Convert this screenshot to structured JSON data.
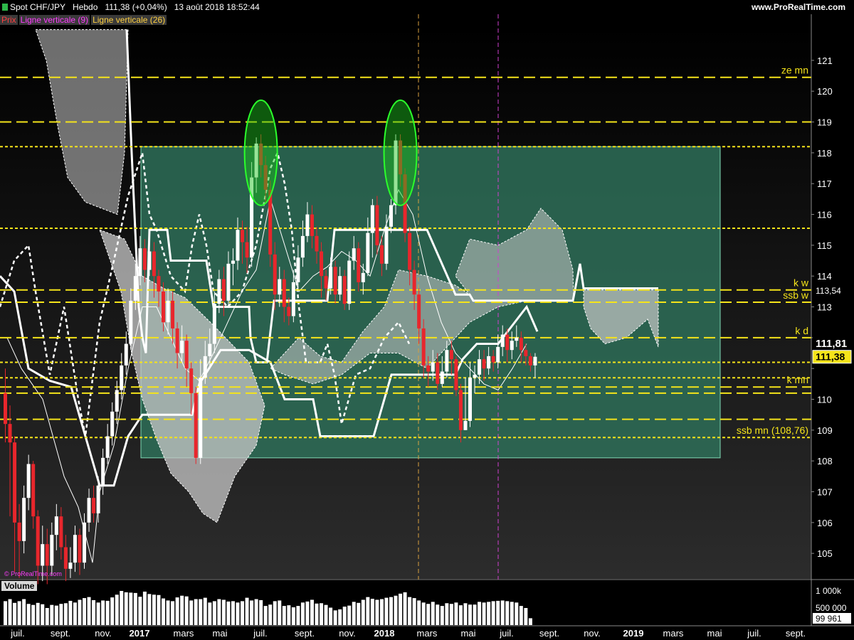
{
  "header": {
    "instrument": "Spot CHF/JPY",
    "timeframe": "Hebdo",
    "last_change": "111,38 (+0,04%)",
    "datetime": "13 août 2018 18:52:44",
    "site": "www.ProRealTime.com"
  },
  "indicators": {
    "price": "Prix",
    "vline9": "Ligne verticale (9)",
    "vline26": "Ligne verticale (26)",
    "colors": {
      "price": "#ff4040",
      "vline9": "#ff3cff",
      "vline26": "#ffd040"
    }
  },
  "copyright": "© ProRealTime.com",
  "volume_title": "Volume",
  "colors": {
    "up": "#ffffff",
    "down": "#e8262c",
    "level": "#f5e41a",
    "box_fill": "#2e6e58",
    "cloud": "#c8c8c8",
    "ellipse": "#19c019"
  },
  "chart_data": [
    {
      "type": "candlestick",
      "title": "Spot CHF/JPY",
      "x_ticks": [
        "juil.",
        "sept.",
        "nov.",
        "2017",
        "mars",
        "mai",
        "juil.",
        "sept.",
        "nov.",
        "2018",
        "mars",
        "mai",
        "juil.",
        "sept.",
        "nov.",
        "2019",
        "mars",
        "mai",
        "juil.",
        "sept."
      ],
      "ylim": [
        104,
        122
      ],
      "y_ticks": [
        105,
        106,
        107,
        108,
        109,
        110,
        111,
        112,
        113,
        114,
        115,
        116,
        117,
        118,
        119,
        120,
        121
      ],
      "y_tick_labels": [
        "105",
        "106",
        "107",
        "108",
        "109",
        "110",
        "",
        "",
        "113",
        "114",
        "115",
        "116",
        "117",
        "118",
        "119",
        "120",
        "121"
      ],
      "last_price": "111,38",
      "price_tags": [
        "113,54",
        "111,81",
        "111,38"
      ],
      "levels": [
        {
          "label": "ze mn",
          "value": 120.45,
          "style": "long-dash"
        },
        {
          "label": "",
          "value": 119.0,
          "style": "long-dash"
        },
        {
          "label": "",
          "value": 118.2,
          "style": "short-dash"
        },
        {
          "label": "",
          "value": 115.55,
          "style": "short-dash"
        },
        {
          "label": "k w",
          "value": 113.55,
          "style": "long-dash"
        },
        {
          "label": "ssb w",
          "value": 113.15,
          "style": "long-dash"
        },
        {
          "label": "k d",
          "value": 112.0,
          "style": "long-dash"
        },
        {
          "label": "",
          "value": 111.2,
          "style": "short-dash"
        },
        {
          "label": "",
          "value": 110.7,
          "style": "short-dash"
        },
        {
          "label": "k mn",
          "value": 110.4,
          "style": "long-dash"
        },
        {
          "label": "",
          "value": 110.2,
          "style": "long-dash"
        },
        {
          "label": "",
          "value": 109.35,
          "style": "long-dash"
        },
        {
          "label": "ssb mn (108,76)",
          "value": 108.76,
          "style": "short-dash"
        }
      ],
      "candles": [
        [
          110.2,
          109.2,
          111.0,
          108.6
        ],
        [
          109.2,
          108.6,
          109.8,
          106.2
        ],
        [
          108.6,
          106.0,
          108.8,
          104.4
        ],
        [
          106.0,
          105.4,
          106.6,
          104.2
        ],
        [
          105.4,
          106.8,
          107.2,
          105.0
        ],
        [
          106.8,
          107.9,
          108.2,
          106.4
        ],
        [
          107.9,
          106.2,
          108.0,
          105.8
        ],
        [
          106.2,
          104.6,
          106.4,
          104.0
        ],
        [
          104.6,
          105.3,
          105.9,
          104.1
        ],
        [
          105.3,
          104.6,
          105.8,
          104.0
        ],
        [
          104.6,
          105.6,
          106.0,
          104.3
        ],
        [
          105.6,
          106.2,
          106.6,
          105.1
        ],
        [
          106.2,
          105.2,
          106.5,
          104.8
        ],
        [
          105.2,
          104.5,
          105.6,
          104.1
        ],
        [
          104.5,
          104.7,
          105.2,
          104.2
        ],
        [
          104.7,
          105.6,
          105.9,
          104.4
        ],
        [
          105.6,
          104.7,
          105.8,
          104.3
        ],
        [
          104.7,
          106.0,
          106.3,
          104.5
        ],
        [
          106.0,
          106.8,
          107.1,
          105.7
        ],
        [
          106.8,
          106.3,
          107.2,
          106.0
        ],
        [
          106.3,
          107.2,
          107.5,
          106.0
        ],
        [
          107.2,
          108.1,
          108.4,
          106.9
        ],
        [
          108.1,
          108.8,
          109.2,
          107.9
        ],
        [
          108.8,
          109.6,
          109.9,
          108.5
        ],
        [
          109.6,
          110.3,
          110.6,
          109.2
        ],
        [
          110.3,
          111.1,
          111.5,
          110.0
        ],
        [
          111.1,
          111.8,
          112.2,
          110.8
        ],
        [
          111.8,
          113.2,
          113.6,
          111.6
        ],
        [
          113.2,
          114.0,
          114.4,
          112.9
        ],
        [
          114.0,
          114.9,
          115.3,
          113.7
        ],
        [
          114.9,
          114.2,
          115.2,
          113.8
        ],
        [
          114.2,
          114.8,
          115.4,
          114.0
        ],
        [
          114.8,
          114.0,
          115.1,
          113.3
        ],
        [
          114.0,
          113.5,
          114.2,
          113.0
        ],
        [
          113.5,
          112.5,
          113.8,
          112.2
        ],
        [
          112.5,
          113.2,
          113.6,
          112.1
        ],
        [
          113.2,
          112.3,
          113.5,
          111.8
        ],
        [
          112.3,
          111.5,
          112.5,
          111.0
        ],
        [
          111.5,
          111.9,
          112.4,
          111.2
        ],
        [
          111.9,
          111.0,
          112.1,
          110.4
        ],
        [
          111.0,
          110.2,
          111.2,
          109.5
        ],
        [
          110.2,
          108.1,
          110.4,
          107.9
        ],
        [
          108.1,
          110.7,
          111.3,
          107.9
        ],
        [
          110.7,
          111.4,
          111.9,
          110.5
        ],
        [
          111.4,
          111.8,
          112.3,
          111.0
        ],
        [
          111.8,
          113.1,
          113.5,
          111.5
        ],
        [
          113.1,
          113.9,
          114.2,
          112.8
        ],
        [
          113.9,
          113.2,
          114.3,
          112.7
        ],
        [
          113.2,
          114.4,
          114.8,
          113.0
        ],
        [
          114.4,
          114.5,
          114.9,
          113.7
        ],
        [
          114.5,
          115.5,
          115.9,
          114.2
        ],
        [
          115.5,
          115.1,
          115.8,
          114.4
        ],
        [
          115.1,
          114.6,
          115.6,
          114.1
        ],
        [
          114.6,
          117.2,
          117.7,
          114.3
        ],
        [
          117.2,
          118.3,
          118.5,
          116.7
        ],
        [
          118.3,
          117.6,
          118.6,
          117.2
        ],
        [
          117.6,
          116.8,
          117.9,
          116.4
        ],
        [
          116.8,
          114.7,
          117.1,
          114.3
        ],
        [
          114.7,
          113.4,
          115.1,
          112.9
        ],
        [
          113.4,
          113.9,
          114.3,
          113.0
        ],
        [
          113.9,
          113.0,
          114.2,
          112.5
        ],
        [
          113.0,
          112.7,
          113.3,
          112.4
        ],
        [
          112.7,
          113.8,
          114.2,
          112.5
        ],
        [
          113.8,
          114.6,
          115.0,
          113.6
        ],
        [
          114.6,
          115.3,
          115.8,
          114.3
        ],
        [
          115.3,
          116.0,
          116.4,
          115.1
        ],
        [
          116.0,
          115.3,
          116.3,
          114.9
        ],
        [
          115.3,
          114.8,
          115.6,
          114.4
        ],
        [
          114.8,
          114.0,
          115.1,
          113.3
        ],
        [
          114.0,
          113.6,
          114.2,
          113.2
        ],
        [
          113.6,
          114.3,
          114.6,
          113.4
        ],
        [
          114.3,
          113.4,
          114.5,
          113.1
        ],
        [
          113.4,
          114.0,
          114.3,
          113.2
        ],
        [
          114.0,
          113.1,
          114.2,
          112.9
        ],
        [
          113.1,
          114.5,
          114.8,
          112.9
        ],
        [
          114.5,
          114.9,
          115.3,
          114.2
        ],
        [
          114.9,
          113.8,
          115.1,
          113.5
        ],
        [
          113.8,
          114.1,
          114.4,
          113.4
        ],
        [
          114.1,
          115.4,
          115.9,
          114.0
        ],
        [
          115.4,
          116.3,
          116.5,
          114.6
        ],
        [
          116.3,
          115.0,
          116.6,
          114.7
        ],
        [
          115.0,
          114.4,
          115.3,
          114.0
        ],
        [
          114.4,
          115.6,
          116.0,
          114.2
        ],
        [
          115.6,
          116.3,
          116.5,
          115.4
        ],
        [
          116.3,
          118.4,
          118.6,
          116.0
        ],
        [
          118.4,
          117.3,
          118.6,
          116.9
        ],
        [
          117.3,
          115.4,
          117.5,
          115.1
        ],
        [
          115.4,
          114.2,
          115.6,
          113.7
        ],
        [
          114.2,
          113.4,
          114.5,
          112.9
        ],
        [
          113.4,
          112.3,
          113.6,
          111.8
        ],
        [
          112.3,
          111.1,
          112.6,
          110.7
        ],
        [
          111.1,
          110.9,
          111.4,
          110.4
        ],
        [
          110.9,
          111.2,
          111.6,
          110.6
        ],
        [
          111.2,
          110.5,
          111.5,
          110.3
        ],
        [
          110.5,
          110.9,
          111.4,
          110.4
        ],
        [
          110.9,
          111.6,
          111.9,
          110.7
        ],
        [
          111.6,
          111.3,
          111.9,
          110.8
        ],
        [
          111.3,
          110.3,
          111.4,
          110.1
        ],
        [
          110.3,
          109.0,
          110.5,
          108.6
        ],
        [
          109.0,
          109.3,
          110.7,
          109.0
        ],
        [
          109.3,
          110.7,
          111.2,
          109.1
        ],
        [
          110.7,
          110.8,
          111.1,
          110.2
        ],
        [
          110.8,
          111.3,
          111.6,
          110.5
        ],
        [
          111.3,
          111.0,
          111.6,
          110.6
        ],
        [
          111.0,
          111.4,
          111.7,
          110.8
        ],
        [
          111.4,
          111.2,
          111.6,
          110.9
        ],
        [
          111.2,
          111.7,
          112.1,
          111.0
        ],
        [
          111.7,
          112.1,
          112.4,
          111.4
        ],
        [
          112.1,
          111.6,
          112.3,
          111.2
        ],
        [
          111.6,
          111.9,
          112.2,
          111.3
        ],
        [
          111.9,
          112.0,
          112.4,
          111.7
        ],
        [
          112.0,
          111.6,
          112.2,
          111.2
        ],
        [
          111.6,
          111.4,
          111.8,
          111.1
        ],
        [
          111.4,
          111.1,
          111.5,
          110.9
        ],
        [
          111.1,
          111.38,
          111.5,
          110.7
        ]
      ],
      "ellipses": [
        {
          "x_index": 55,
          "y_center": 118.0
        },
        {
          "x_index": 85,
          "y_center": 118.0
        }
      ]
    },
    {
      "type": "bar",
      "title": "Volume",
      "y_ticks": [
        "1 000k",
        "500 000"
      ],
      "last_value": "99 961",
      "values": [
        700,
        760,
        650,
        700,
        760,
        620,
        590,
        650,
        610,
        500,
        590,
        570,
        620,
        640,
        710,
        660,
        740,
        790,
        820,
        730,
        660,
        720,
        710,
        810,
        890,
        1000,
        960,
        950,
        940,
        830,
        980,
        910,
        890,
        880,
        780,
        720,
        700,
        810,
        860,
        840,
        720,
        760,
        760,
        800,
        660,
        700,
        760,
        740,
        690,
        700,
        660,
        700,
        800,
        720,
        760,
        730,
        560,
        600,
        700,
        720,
        560,
        580,
        520,
        560,
        660,
        690,
        740,
        630,
        640,
        590,
        510,
        430,
        460,
        540,
        570,
        680,
        650,
        740,
        820,
        770,
        740,
        760,
        800,
        820,
        860,
        920,
        960,
        820,
        790,
        720,
        660,
        620,
        680,
        600,
        560,
        640,
        620,
        660,
        580,
        640,
        600,
        600,
        680,
        660,
        680,
        700,
        710,
        720,
        700,
        680,
        660,
        560,
        500,
        200
      ]
    }
  ]
}
